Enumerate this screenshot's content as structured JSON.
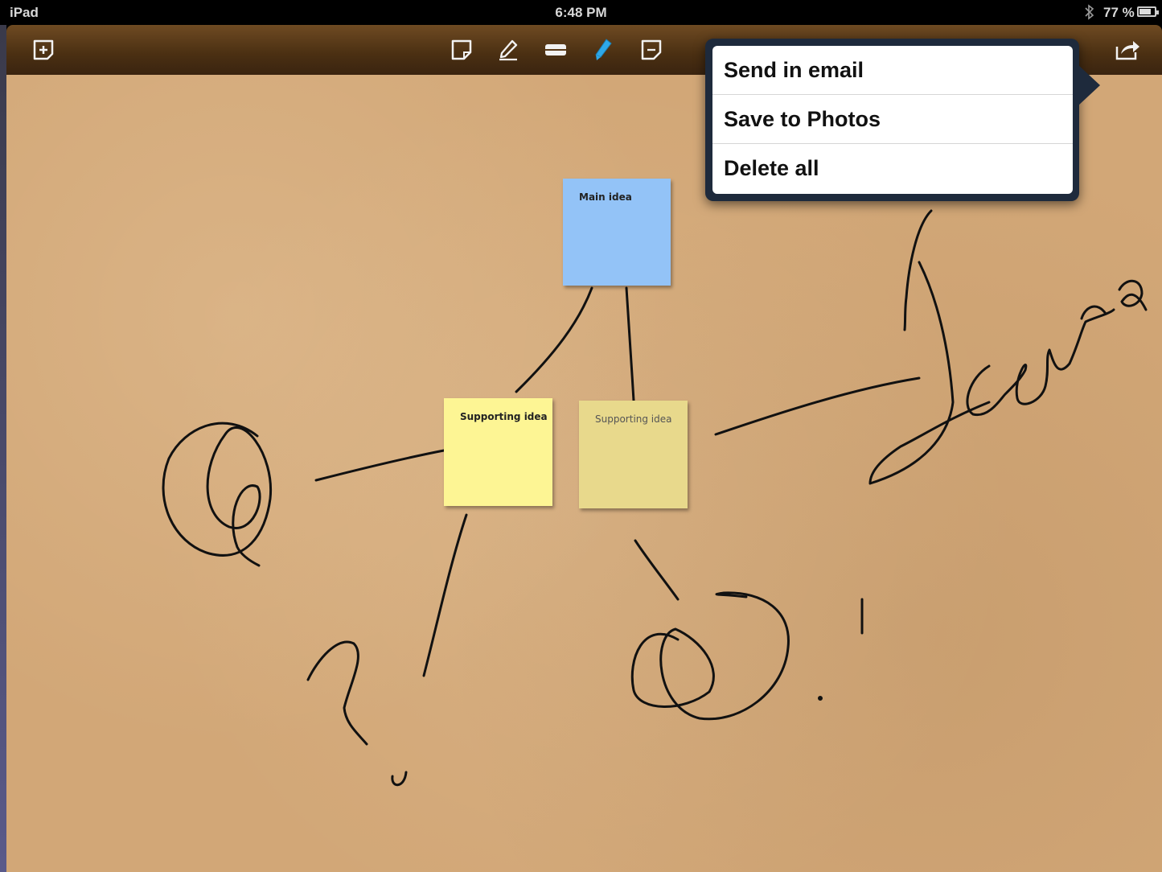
{
  "status_bar": {
    "device": "iPad",
    "time": "6:48 PM",
    "battery": "77 %",
    "battery_level": 0.77
  },
  "toolbar": {
    "left_icon": "add-note-icon",
    "tools": [
      "sticky-note-icon",
      "pencil-icon",
      "eraser-icon",
      "marker-icon",
      "note-tool-icon"
    ],
    "selected_tool": "marker-icon",
    "right_icon": "share-icon",
    "accent": "#2ea8e8"
  },
  "notes": {
    "main": {
      "text": "Main idea",
      "color": "#93c3f7"
    },
    "supporting_1": {
      "text": "Supporting idea",
      "color": "#fdf594"
    },
    "supporting_2": {
      "text": "Supporting idea",
      "color": "#e8d98c"
    }
  },
  "share_menu": {
    "items": [
      "Send in email",
      "Save to Photos",
      "Delete all"
    ]
  }
}
